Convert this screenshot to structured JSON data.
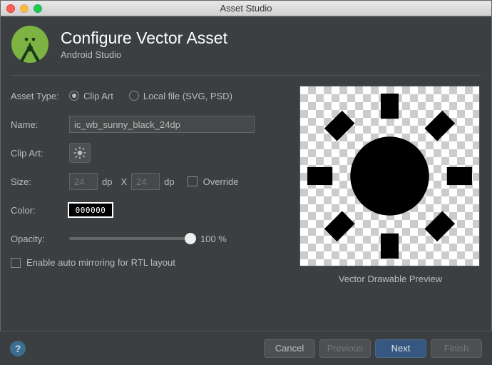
{
  "window": {
    "title": "Asset Studio"
  },
  "header": {
    "title": "Configure Vector Asset",
    "subtitle": "Android Studio"
  },
  "form": {
    "asset_type": {
      "label": "Asset Type:",
      "opt_clipart": "Clip Art",
      "opt_local": "Local file (SVG, PSD)",
      "selected": "clipart"
    },
    "name": {
      "label": "Name:",
      "value": "ic_wb_sunny_black_24dp"
    },
    "clipart": {
      "label": "Clip Art:"
    },
    "size": {
      "label": "Size:",
      "w": "24",
      "h": "24",
      "unit": "dp",
      "sep": "X",
      "override": "Override"
    },
    "color": {
      "label": "Color:",
      "value": "000000"
    },
    "opacity": {
      "label": "Opacity:",
      "value": "100 %"
    },
    "mirror": {
      "label": "Enable auto mirroring for RTL layout"
    }
  },
  "preview": {
    "caption": "Vector Drawable Preview"
  },
  "footer": {
    "cancel": "Cancel",
    "previous": "Previous",
    "next": "Next",
    "finish": "Finish"
  }
}
